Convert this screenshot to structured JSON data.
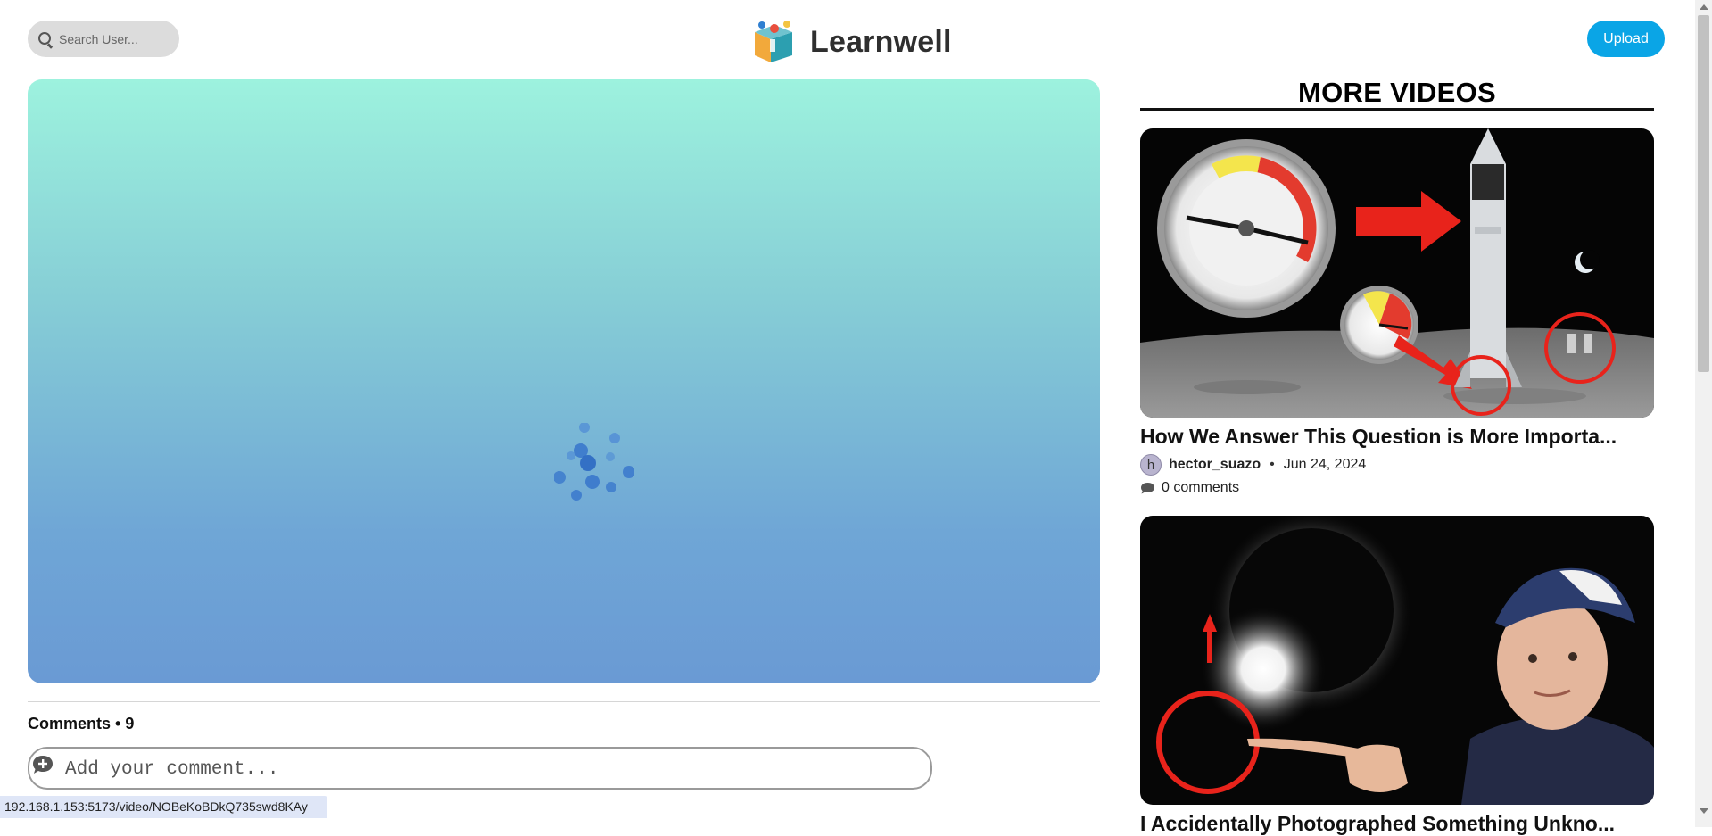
{
  "search": {
    "placeholder": "Search User..."
  },
  "brand": {
    "name": "Learnwell"
  },
  "header": {
    "upload_label": "Upload"
  },
  "comments": {
    "header": "Comments • 9",
    "input_placeholder": "Add your comment..."
  },
  "status_bar": {
    "url": "192.168.1.153:5173/video/NOBeKoBDkQ735swd8KAy"
  },
  "sidebar": {
    "title": "MORE VIDEOS",
    "videos": [
      {
        "title": "How We Answer This Question is More Importa...",
        "avatar_letter": "h",
        "author": "hector_suazo",
        "separator": "•",
        "date": "Jun 24, 2024",
        "comments": "0 comments"
      },
      {
        "title": "I Accidentally Photographed Something Unkno..."
      }
    ]
  },
  "colors": {
    "accent": "#0aa5e6",
    "player_top": "#9df2de",
    "player_bottom": "#6a9ad4"
  }
}
